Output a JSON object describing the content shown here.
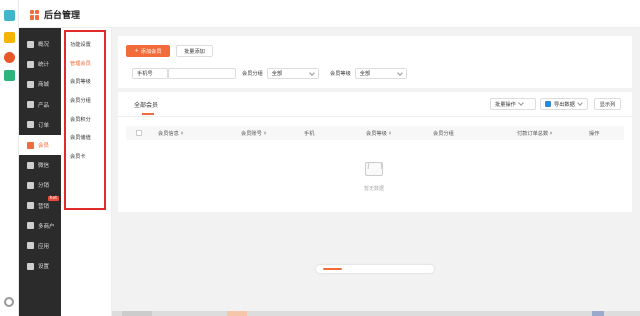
{
  "brand": {
    "title": "后台管理"
  },
  "nav": {
    "items": [
      {
        "label": "概况"
      },
      {
        "label": "统计"
      },
      {
        "label": "商城"
      },
      {
        "label": "产品"
      },
      {
        "label": "订单"
      },
      {
        "label": "会员"
      },
      {
        "label": "微信"
      },
      {
        "label": "分销"
      },
      {
        "label": "营销"
      },
      {
        "label": "多商户"
      },
      {
        "label": "应用"
      },
      {
        "label": "设置"
      }
    ],
    "hot_badge": "hot"
  },
  "subnav": {
    "items": [
      {
        "label": "功能设置"
      },
      {
        "label": "管理会员"
      },
      {
        "label": "会员等级"
      },
      {
        "label": "会员分组"
      },
      {
        "label": "会员积分"
      },
      {
        "label": "会员储值"
      },
      {
        "label": "会员卡"
      }
    ]
  },
  "toolbar": {
    "add_member": "添加会员",
    "batch_add": "批量添加"
  },
  "filters": {
    "phone_label": "手机号",
    "group_label": "会员分组",
    "group_value": "全部",
    "level_label": "会员等级",
    "level_value": "全部"
  },
  "list": {
    "tab_all": "全部会员",
    "batch_ops": "批量操作",
    "export": "导出数据",
    "columns_btn": "显示列",
    "columns": [
      "会员信息",
      "会员账号",
      "手机",
      "会员等级",
      "会员分组",
      "付款订单总数",
      "操作"
    ],
    "empty_text": "暂无数据"
  },
  "scroll": {
    "progress": 0.18
  },
  "colors": {
    "accent": "#f26b3a",
    "nav_bg": "#2b2b2b",
    "highlight_outline": "#e02b2b"
  }
}
